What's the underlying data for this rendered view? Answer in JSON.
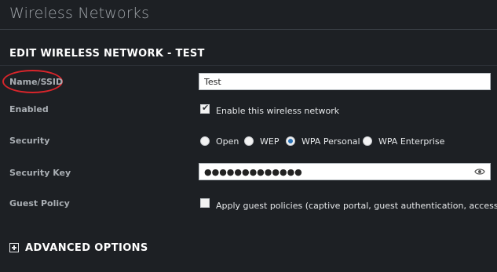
{
  "page": {
    "title": "Wireless Networks",
    "section_title": "EDIT WIRELESS NETWORK - TEST"
  },
  "form": {
    "name": {
      "label": "Name/SSID",
      "value": "Test"
    },
    "enabled": {
      "label": "Enabled",
      "checkbox_label": "Enable this wireless network",
      "checked": true
    },
    "security": {
      "label": "Security",
      "options": [
        "Open",
        "WEP",
        "WPA Personal",
        "WPA Enterprise"
      ],
      "selected": "WPA Personal"
    },
    "security_key": {
      "label": "Security Key",
      "value": "●●●●●●●●●●●●●"
    },
    "guest_policy": {
      "label": "Guest Policy",
      "checkbox_label": "Apply guest policies (captive portal, guest authentication, access)",
      "checked": false
    }
  },
  "advanced": {
    "label": "ADVANCED OPTIONS"
  },
  "colors": {
    "highlight_ring": "#d8252b",
    "radio_selected": "#2c73b6",
    "background": "#1d2024"
  }
}
